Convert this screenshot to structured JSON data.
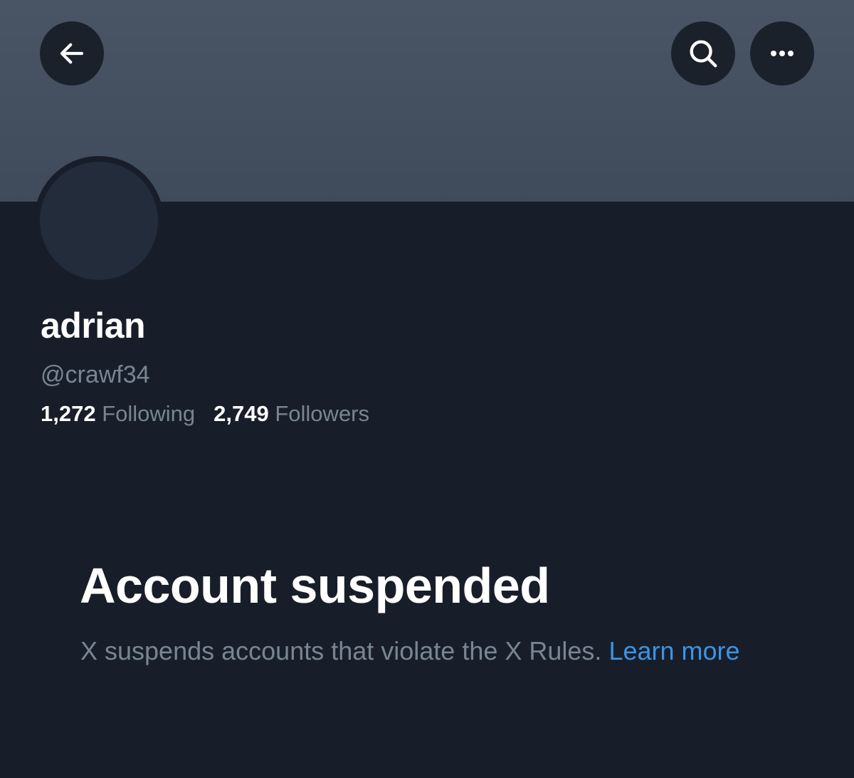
{
  "header": {
    "back_icon": "arrow-left-icon",
    "search_icon": "search-icon",
    "more_icon": "more-horizontal-icon"
  },
  "profile": {
    "display_name": "adrian",
    "handle": "@crawf34",
    "following_count": "1,272",
    "following_label": "Following",
    "followers_count": "2,749",
    "followers_label": "Followers"
  },
  "notice": {
    "title": "Account suspended",
    "description": "X suspends accounts that violate the X Rules.",
    "link_label": "Learn more"
  },
  "colors": {
    "background": "#181e29",
    "banner": "#445060",
    "button_bg": "#1b212b",
    "muted_text": "#788593",
    "link": "#3b93e6"
  }
}
